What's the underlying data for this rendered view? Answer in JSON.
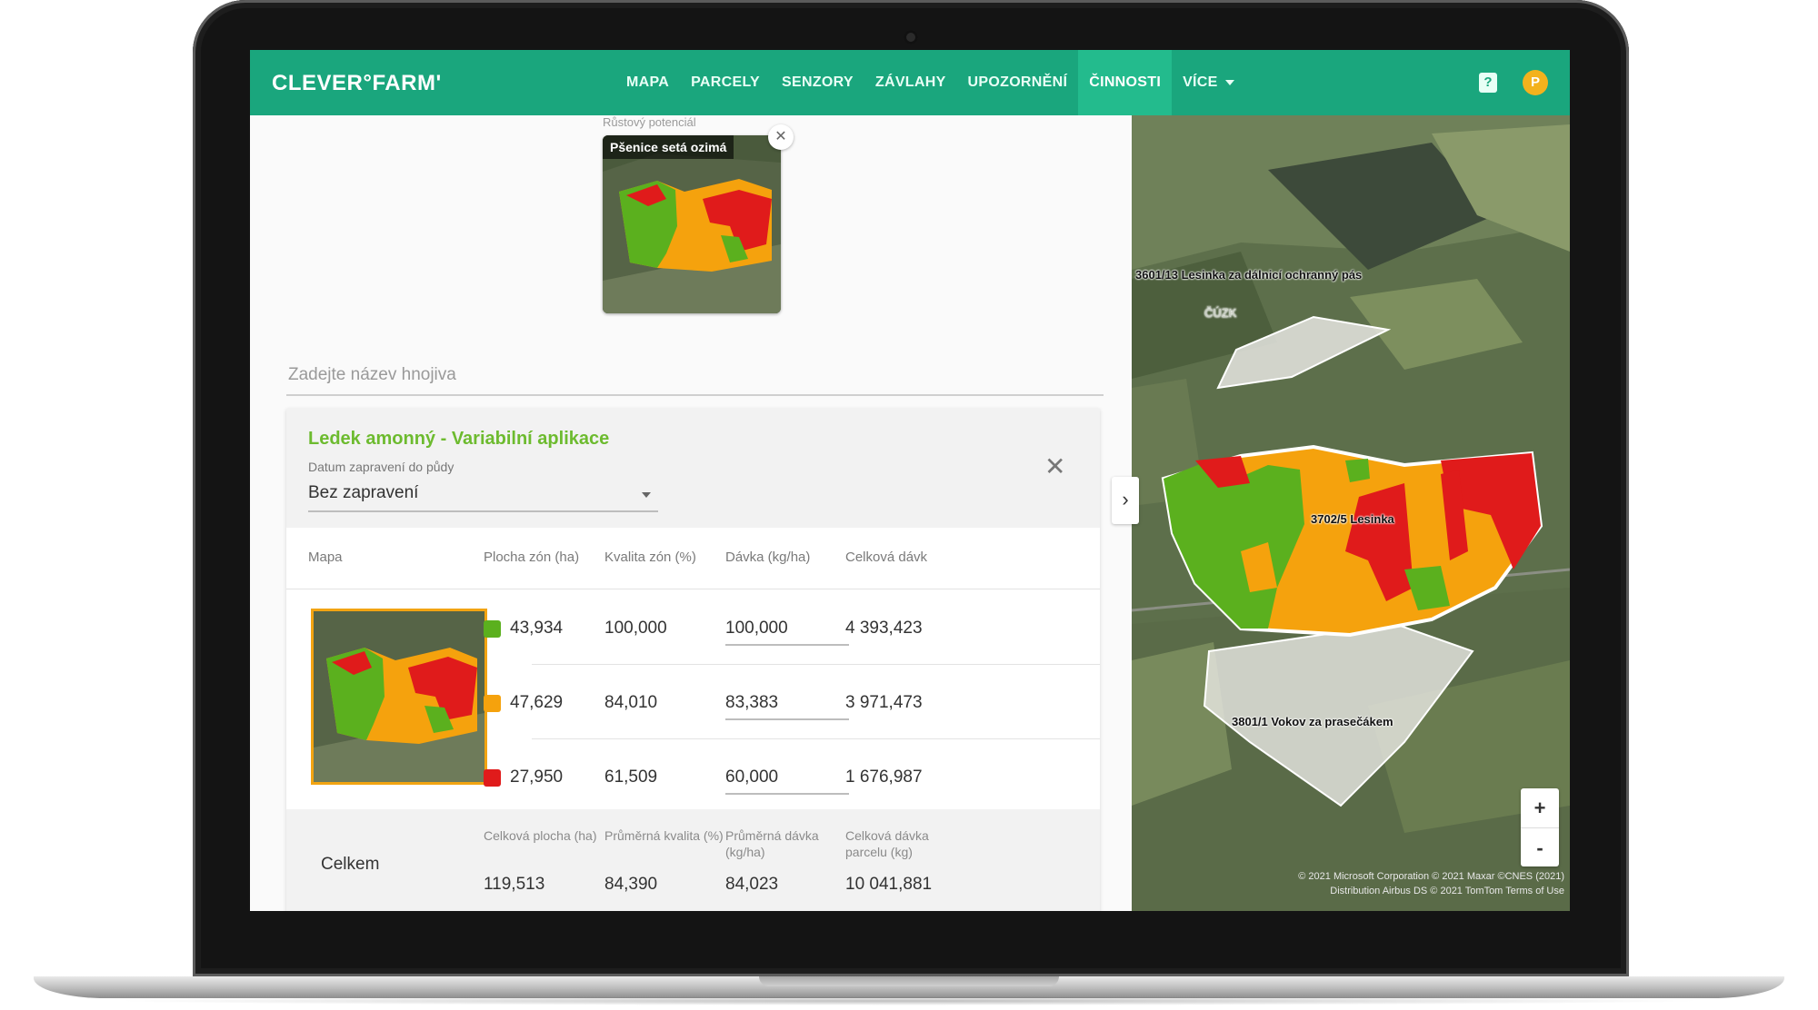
{
  "app": {
    "logo": "CLEVER°FARM'",
    "nav": [
      {
        "label": "MAPA"
      },
      {
        "label": "PARCELY"
      },
      {
        "label": "SENZORY"
      },
      {
        "label": "ZÁVLAHY"
      },
      {
        "label": "UPOZORNĚNÍ"
      },
      {
        "label": "ČINNOSTI"
      },
      {
        "label": "VÍCE"
      }
    ],
    "active_nav": "ČINNOSTI",
    "user_initial": "P",
    "help_glyph": "?"
  },
  "growth_potential": {
    "label": "Růstový potenciál",
    "crop": "Pšenice setá ozimá"
  },
  "fertilizer_search": {
    "placeholder": "Zadejte název hnojiva"
  },
  "application": {
    "title": "Ledek amonný - Variabilní aplikace",
    "incorporation_label": "Datum zapravení do půdy",
    "incorporation_value": "Bez zapravení",
    "columns": {
      "map": "Mapa",
      "area": "Plocha zón (ha)",
      "quality": "Kvalita zón (%)",
      "dose": "Dávka (kg/ha)",
      "total": "Celková dávk"
    },
    "rows": [
      {
        "color": "#5bb01e",
        "area": "43,934",
        "quality": "100,000",
        "dose": "100,000",
        "total": "4 393,423"
      },
      {
        "color": "#f5a20d",
        "area": "47,629",
        "quality": "84,010",
        "dose": "83,383",
        "total": "3 971,473"
      },
      {
        "color": "#e01b1b",
        "area": "27,950",
        "quality": "61,509",
        "dose": "60,000",
        "total": "1 676,987"
      }
    ],
    "totals": {
      "label": "Celkem",
      "area_caption": "Celková plocha (ha)",
      "area": "119,513",
      "quality_caption": "Průměrná kvalita (%)",
      "quality": "84,390",
      "dose_caption": "Průměrná dávka (kg/ha)",
      "dose": "84,023",
      "total_caption": "Celková dávka parcelu (kg)",
      "total": "10 041,881"
    }
  },
  "map": {
    "parcels": [
      {
        "label": "3601/13 Lesinka za dálnicí ochranný pás"
      },
      {
        "label": "3702/5 Lesinka"
      },
      {
        "label": "3801/1 Vokov za prasečákem"
      }
    ],
    "place_label": "ČÚZK",
    "zoom_in": "+",
    "zoom_out": "-",
    "collapse_glyph": "›",
    "attribution_line1": "© 2021 Microsoft Corporation © 2021 Maxar ©CNES (2021)",
    "attribution_line2": "Distribution Airbus DS © 2021 TomTom Terms of Use"
  },
  "colors": {
    "brand_green": "#1aa67d",
    "active_tab": "#23bb8d",
    "title_green": "#6dbb2f",
    "zone_green": "#5bb01e",
    "zone_orange": "#f5a20d",
    "zone_red": "#e01b1b"
  }
}
